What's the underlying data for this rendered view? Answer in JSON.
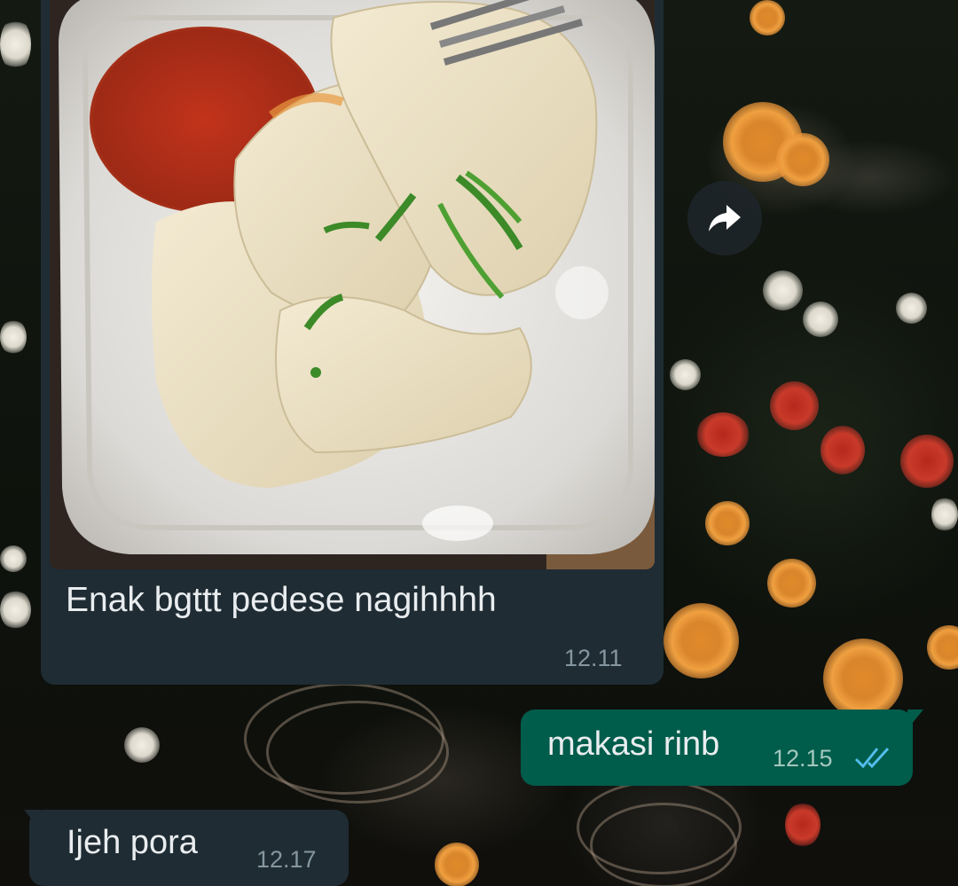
{
  "messages": [
    {
      "direction": "incoming",
      "type": "image",
      "image_description_icon": "dumpling-photo",
      "caption": "Enak bgttt pedese nagihhhh",
      "time": "12.11"
    },
    {
      "direction": "outgoing",
      "type": "text",
      "text": "makasi rinb",
      "time": "12.15",
      "status": "read",
      "status_icon": "double-check-icon"
    },
    {
      "direction": "incoming",
      "type": "text",
      "text": "Ijeh pora",
      "time": "12.17"
    }
  ],
  "actions": {
    "forward_icon": "forward-icon"
  },
  "colors": {
    "incoming_bubble": "#1f2c34",
    "outgoing_bubble": "#005c4b",
    "text": "#e9edef",
    "time_incoming": "#8696a0",
    "time_outgoing": "#a3c7bd",
    "read_ticks": "#53bdeb"
  }
}
